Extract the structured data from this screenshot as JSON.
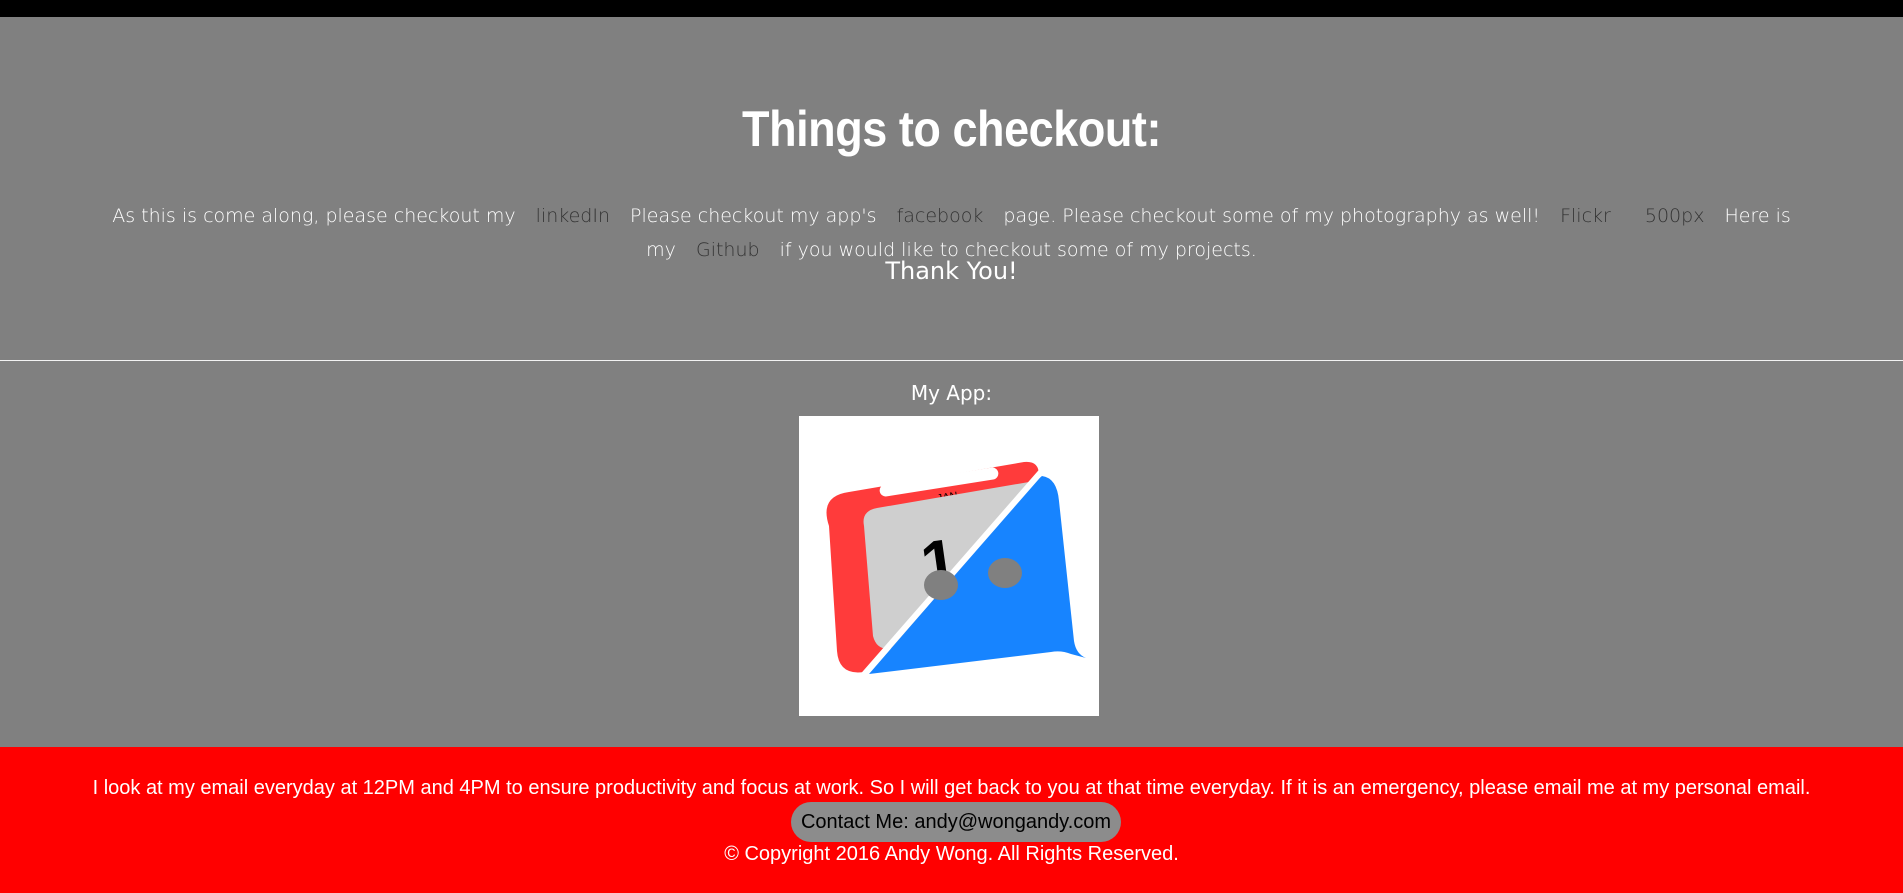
{
  "hero": {
    "title": "Things to checkout:",
    "text_1": "As this is come along, please checkout my",
    "link_linkedin": "linkedIn",
    "text_2": "Please checkout my app's",
    "link_facebook": "facebook",
    "text_3": "page. Please checkout some of my photography as well!",
    "link_flickr": "Flickr",
    "link_500px": "500px",
    "text_4": "Here is my",
    "link_github": "Github",
    "text_5": "if you would like to checkout some of my projects.",
    "thanks": "Thank You!"
  },
  "app": {
    "label": "My App:",
    "icon_month": "JAN",
    "icon_day": "1",
    "icon_name": "calendar-chat-app-icon",
    "colors": {
      "red": "#ff3b3b",
      "blue": "#1784ff",
      "gray": "#cccccc"
    }
  },
  "footer": {
    "note": "I look at my email everyday at 12PM and 4PM to ensure productivity and focus at work. So I will get back to you at that time everyday. If it is an emergency, please email me at my personal email.",
    "contact": "Contact Me: andy@wongandy.com",
    "copyright": "© Copyright 2016 Andy Wong. All Rights Reserved."
  },
  "colors": {
    "page_bg": "#808080",
    "topbar": "#000000",
    "footer_bg": "#ff0000"
  }
}
